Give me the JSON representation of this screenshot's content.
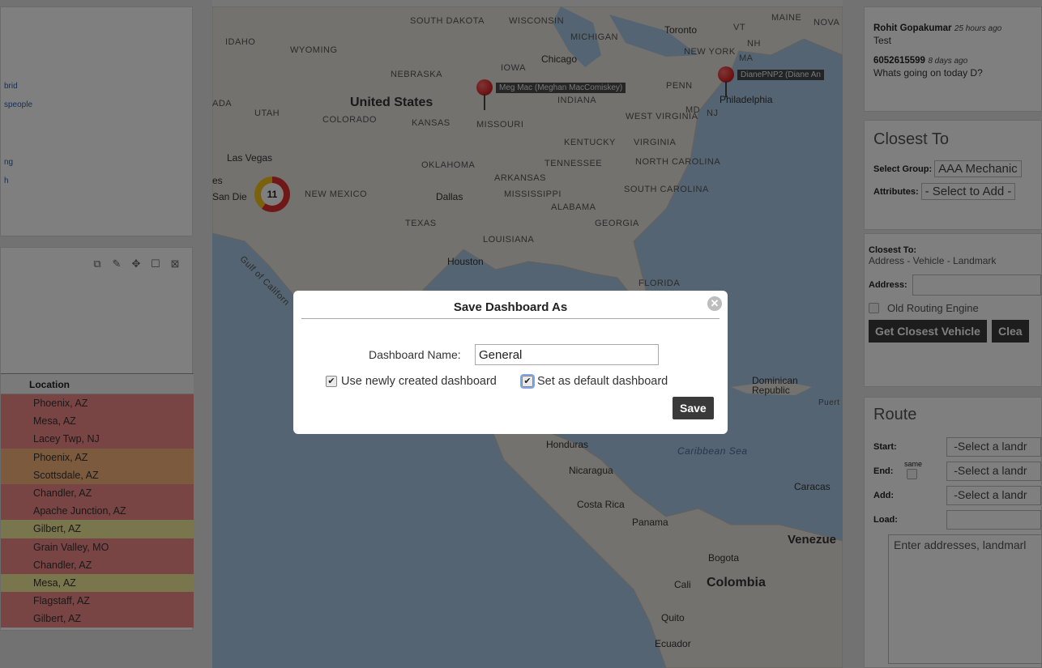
{
  "left": {
    "links": [
      "brid",
      "speople",
      "ng",
      "h"
    ],
    "panel_icons": [
      "copy-icon",
      "edit-icon",
      "move-icon",
      "maximize-icon",
      "close-icon"
    ],
    "table": {
      "header": "Location",
      "rows": [
        {
          "location": "Phoenix, AZ",
          "status": "red"
        },
        {
          "location": "Mesa, AZ",
          "status": "red"
        },
        {
          "location": "Lacey Twp, NJ",
          "status": "red"
        },
        {
          "location": "Phoenix, AZ",
          "status": "orange"
        },
        {
          "location": "Scottsdale, AZ",
          "status": "orange"
        },
        {
          "location": "Chandler, AZ",
          "status": "red"
        },
        {
          "location": "Apache Junction, AZ",
          "status": "red"
        },
        {
          "location": "Gilbert, AZ",
          "status": "yellow"
        },
        {
          "location": "Grain Valley, MO",
          "status": "red"
        },
        {
          "location": "Chandler, AZ",
          "status": "red"
        },
        {
          "location": "Mesa, AZ",
          "status": "yellow"
        },
        {
          "location": "Flagstaff, AZ",
          "status": "red"
        },
        {
          "location": "Gilbert, AZ",
          "status": "red"
        }
      ]
    }
  },
  "map": {
    "labels": {
      "south_dakota": "SOUTH DAKOTA",
      "wisconsin": "WISCONSIN",
      "michigan": "MICHIGAN",
      "toronto": "Toronto",
      "vt": "VT",
      "maine": "MAINE",
      "nova": "NOVA",
      "nh": "NH",
      "idaho": "IDAHO",
      "wyoming": "WYOMING",
      "chicago": "Chicago",
      "new_york": "NEW YORK",
      "ma": "MA",
      "nebraska": "NEBRASKA",
      "iowa": "IOWA",
      "penn": "PENN",
      "united_states": "United States",
      "indiana": "INDIANA",
      "philadelphia": "Philadelphia",
      "ada": "ADA",
      "utah": "UTAH",
      "colorado": "COLORADO",
      "kansas": "KANSAS",
      "missouri": "MISSOURI",
      "west_virginia": "WEST VIRGINIA",
      "md": "MD",
      "nj": "NJ",
      "kentucky": "KENTUCKY",
      "virginia": "VIRGINIA",
      "las_vegas": "Las Vegas",
      "oklahoma": "OKLAHOMA",
      "tennessee": "TENNESSEE",
      "north_carolina": "NORTH CAROLINA",
      "arkansas": "ARKANSAS",
      "es": "es",
      "san_diego": "San Die",
      "new_mexico": "NEW MEXICO",
      "dallas": "Dallas",
      "mississippi": "MISSISSIPPI",
      "south_carolina": "SOUTH CAROLINA",
      "alabama": "ALABAMA",
      "texas": "TEXAS",
      "georgia": "GEORGIA",
      "louisiana": "LOUISIANA",
      "houston": "Houston",
      "gulf": "Gulf of Californ",
      "florida": "FLORIDA",
      "dominican": "Dominican Republic",
      "puert": "Puert",
      "honduras": "Honduras",
      "caribbean": "Caribbean Sea",
      "nicaragua": "Nicaragua",
      "caracas": "Caracas",
      "costa_rica": "Costa Rica",
      "panama": "Panama",
      "venezuela": "Venezue",
      "bogota": "Bogota",
      "cali": "Cali",
      "colombia": "Colombia",
      "quito": "Quito",
      "ecuador": "Ecuador"
    },
    "pins": [
      {
        "label": "Meg Mac (Meghan MacComiskey)"
      },
      {
        "label": "DianePNP2 (Diane An"
      }
    ],
    "cluster_count": "11",
    "colors": {
      "water": "#abc8e4",
      "land": "#e9e5dc",
      "cluster_red": "#e03030",
      "cluster_yellow": "#f4c21c"
    }
  },
  "right": {
    "messages": [
      {
        "author": "Rohit Gopakumar",
        "time": "25 hours ago",
        "text": "Test"
      },
      {
        "author": "6052615599",
        "time": "8 days ago",
        "text": "Whats going on today D?"
      }
    ],
    "closest": {
      "title": "Closest To",
      "select_group_label": "Select Group:",
      "select_group_value": "AAA Mechanic",
      "attributes_label": "Attributes:",
      "attributes_value": "- Select to Add -"
    },
    "closest_form": {
      "closest_to_label": "Closest To:",
      "options_line": "Address - Vehicle - Landmark",
      "address_label": "Address:",
      "old_routing_label": "Old Routing Engine",
      "get_closest_button": "Get Closest Vehicle",
      "clear_button": "Clea"
    },
    "route": {
      "title": "Route",
      "start_label": "Start:",
      "end_label": "End:",
      "same_label": "same",
      "add_label": "Add:",
      "load_label": "Load:",
      "landmark_placeholder": "-Select a landr",
      "textarea_placeholder": "Enter addresses, landmarl"
    }
  },
  "modal": {
    "title": "Save Dashboard As",
    "name_label": "Dashboard Name:",
    "name_value": "General",
    "use_new_label": "Use newly created dashboard",
    "use_new_checked": true,
    "default_label": "Set as default dashboard",
    "default_checked": true,
    "save_button": "Save",
    "close_icon": "close-circle-icon"
  }
}
